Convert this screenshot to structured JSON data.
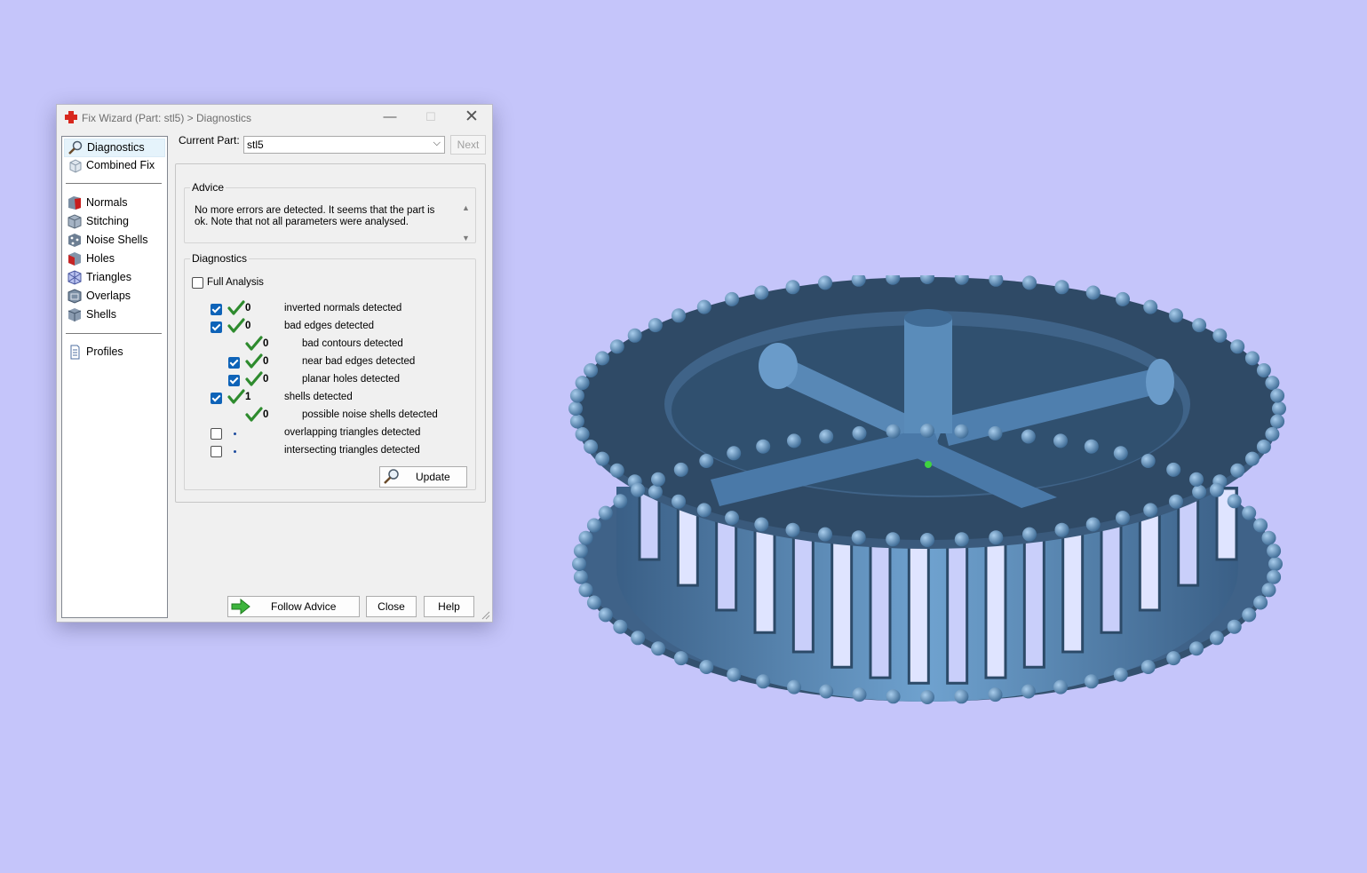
{
  "window": {
    "title": "Fix Wizard (Part: stl5) > Diagnostics",
    "controls": {
      "minimize": "—",
      "maximize": "☐",
      "close": "✕"
    }
  },
  "nav": {
    "items": [
      {
        "label": "Diagnostics",
        "icon": "magnifier-icon",
        "selected": true
      },
      {
        "label": "Combined Fix",
        "icon": "combined-fix-icon"
      },
      {
        "label": "Normals",
        "icon": "normals-icon"
      },
      {
        "label": "Stitching",
        "icon": "stitching-icon"
      },
      {
        "label": "Noise Shells",
        "icon": "noise-shells-icon"
      },
      {
        "label": "Holes",
        "icon": "holes-icon"
      },
      {
        "label": "Triangles",
        "icon": "triangles-icon"
      },
      {
        "label": "Overlaps",
        "icon": "overlaps-icon"
      },
      {
        "label": "Shells",
        "icon": "shells-icon"
      },
      {
        "label": "Profiles",
        "icon": "document-icon"
      }
    ]
  },
  "current_part": {
    "label": "Current Part:",
    "value": "stl5",
    "next_label": "Next"
  },
  "advice": {
    "legend": "Advice",
    "text": "No more errors are detected. It seems that the part is ok. Note that not all parameters were analysed."
  },
  "diagnostics": {
    "legend": "Diagnostics",
    "full_analysis_label": "Full Analysis",
    "full_analysis_checked": false,
    "rows": [
      {
        "checkbox": true,
        "checked": true,
        "ok": true,
        "count": "0",
        "label": "inverted normals detected",
        "indent": 0
      },
      {
        "checkbox": true,
        "checked": true,
        "ok": true,
        "count": "0",
        "label": "bad edges detected",
        "indent": 0
      },
      {
        "checkbox": false,
        "checked": false,
        "ok": true,
        "count": "0",
        "label": "bad contours detected",
        "indent": 1
      },
      {
        "checkbox": true,
        "checked": true,
        "ok": true,
        "count": "0",
        "label": "near bad edges detected",
        "indent": 1
      },
      {
        "checkbox": true,
        "checked": true,
        "ok": true,
        "count": "0",
        "label": "planar holes detected",
        "indent": 1
      },
      {
        "checkbox": true,
        "checked": true,
        "ok": true,
        "count": "1",
        "label": "shells detected",
        "indent": 0
      },
      {
        "checkbox": false,
        "checked": false,
        "ok": true,
        "count": "0",
        "label": "possible noise shells detected",
        "indent": 1
      },
      {
        "checkbox": true,
        "checked": false,
        "ok": false,
        "count": "",
        "label": "overlapping triangles detected",
        "indent": 0
      },
      {
        "checkbox": true,
        "checked": false,
        "ok": false,
        "count": "",
        "label": "intersecting triangles detected",
        "indent": 0
      }
    ],
    "update_label": "Update"
  },
  "buttons": {
    "follow_advice": "Follow Advice",
    "close": "Close",
    "help": "Help"
  },
  "colors": {
    "background": "#c5c5fa",
    "model": "#4f7fae",
    "model_dark": "#33506e",
    "check_green": "#2e8b2e",
    "accent": "#0e63b8"
  }
}
